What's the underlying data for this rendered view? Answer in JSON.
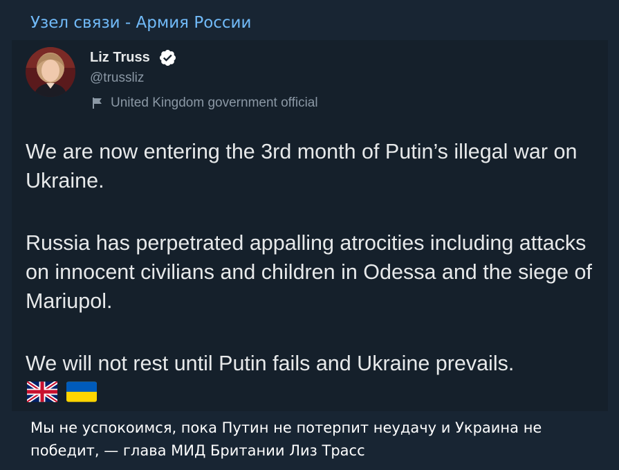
{
  "channel": {
    "name": "Узел связи - Армия России"
  },
  "tweet": {
    "author": {
      "name": "Liz Truss",
      "handle": "@trussliz",
      "label": "United Kingdom government official",
      "verified_color": "#ffffff"
    },
    "paragraphs": [
      "We are now entering the 3rd month of Putin’s illegal war on Ukraine.",
      "Russia has perpetrated appalling atrocities including attacks on innocent civilians and children in Odessa and the siege of Mariupol.",
      "We will not rest until Putin fails and Ukraine prevails."
    ],
    "emojis": [
      "uk-flag-icon",
      "ukraine-flag-icon"
    ]
  },
  "caption": "Мы не успокоимся, пока Путин не потерпит неудачу и Украина не победит, — глава МИД Британии Лиз Трасс",
  "colors": {
    "background": "#182533",
    "tweet_background": "#15202b",
    "channel_name": "#71baf8",
    "tweet_text": "#e7e9ea",
    "secondary_text": "#8b98a5"
  }
}
